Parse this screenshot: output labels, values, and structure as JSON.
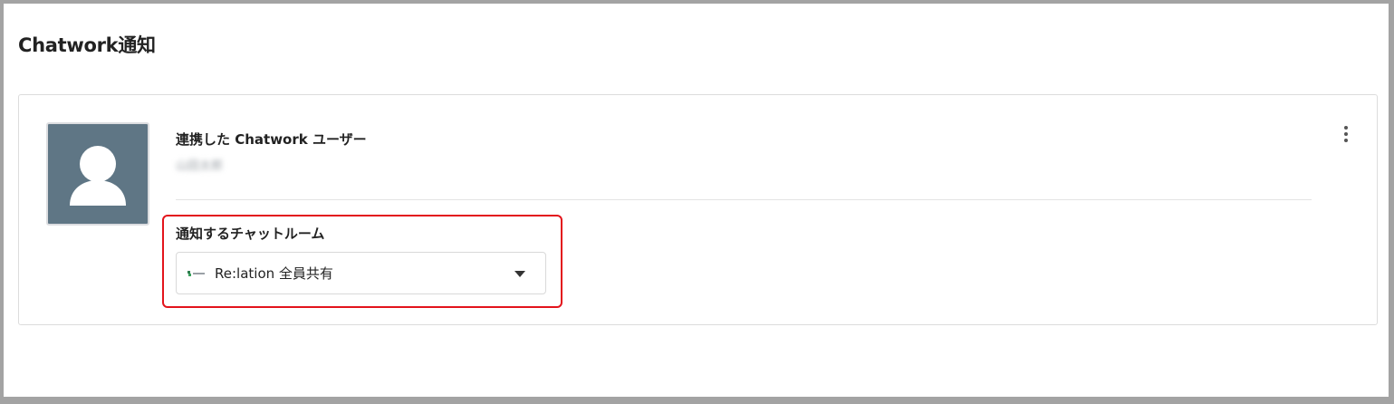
{
  "page": {
    "title": "Chatwork通知"
  },
  "card": {
    "avatar_icon": "user-silhouette-icon",
    "linked_user_label": "連携した Chatwork ユーザー",
    "linked_user_name": "山田太郎",
    "menu_icon": "more-vertical-icon",
    "room_label": "通知するチャットルーム",
    "room_select": {
      "icon": "chatroom-logo-icon",
      "value": "Re:lation 全員共有"
    }
  },
  "colors": {
    "avatar_bg": "#5f7685",
    "highlight_border": "#e3141c",
    "frame_border": "#a3a3a3"
  }
}
